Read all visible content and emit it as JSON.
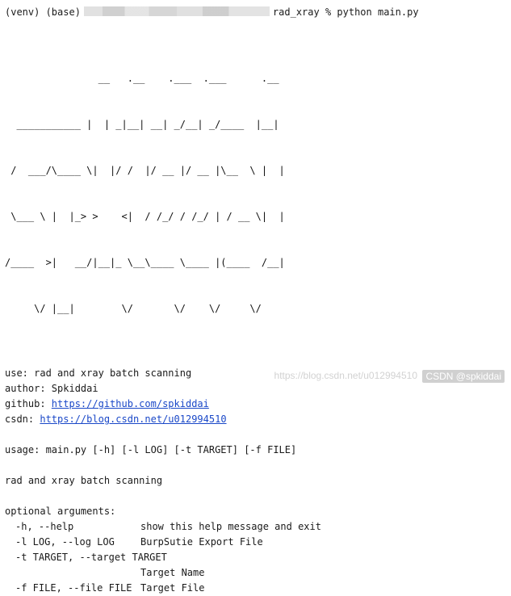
{
  "prompt": {
    "env_prefix": "(venv) (base)",
    "dir_and_command": "rad_xray % python main.py"
  },
  "banner_lines": [
    "                __   .__    .___  .___      .__",
    "  ___________ |  | _|__| __| _/__| _/____  |__|",
    " /  ___/\\____ \\|  |/ /  |/ __ |/ __ |\\__  \\ |  |",
    " \\___ \\ |  |_> >    <|  / /_/ / /_/ | / __ \\|  |",
    "/____  >|   __/|__|_ \\__\\____ \\____ |(____  /__|",
    "     \\/ |__|        \\/       \\/    \\/     \\/"
  ],
  "info": {
    "use": "use: rad and xray batch scanning",
    "author": "author: Spkiddai",
    "github_label": "github: ",
    "github_url": "https://github.com/spkiddai",
    "csdn_label": "csdn: ",
    "csdn_url": "https://blog.csdn.net/u012994510"
  },
  "usage": "usage: main.py [-h] [-l LOG] [-t TARGET] [-f FILE]",
  "description": "rad and xray batch scanning",
  "optional_header": "optional arguments:",
  "options": [
    {
      "flag": "-h, --help",
      "desc": "show this help message and exit"
    },
    {
      "flag": "-l LOG, --log LOG",
      "desc": "BurpSutie Export File"
    },
    {
      "flag": "-t TARGET, --target TARGET",
      "desc": ""
    },
    {
      "flag": "",
      "desc": "Target Name"
    },
    {
      "flag": "-f FILE, --file FILE",
      "desc": "Target File"
    }
  ],
  "watermark": {
    "faint": "https://blog.csdn.net/u012994510",
    "label": "CSDN @spkiddai"
  }
}
